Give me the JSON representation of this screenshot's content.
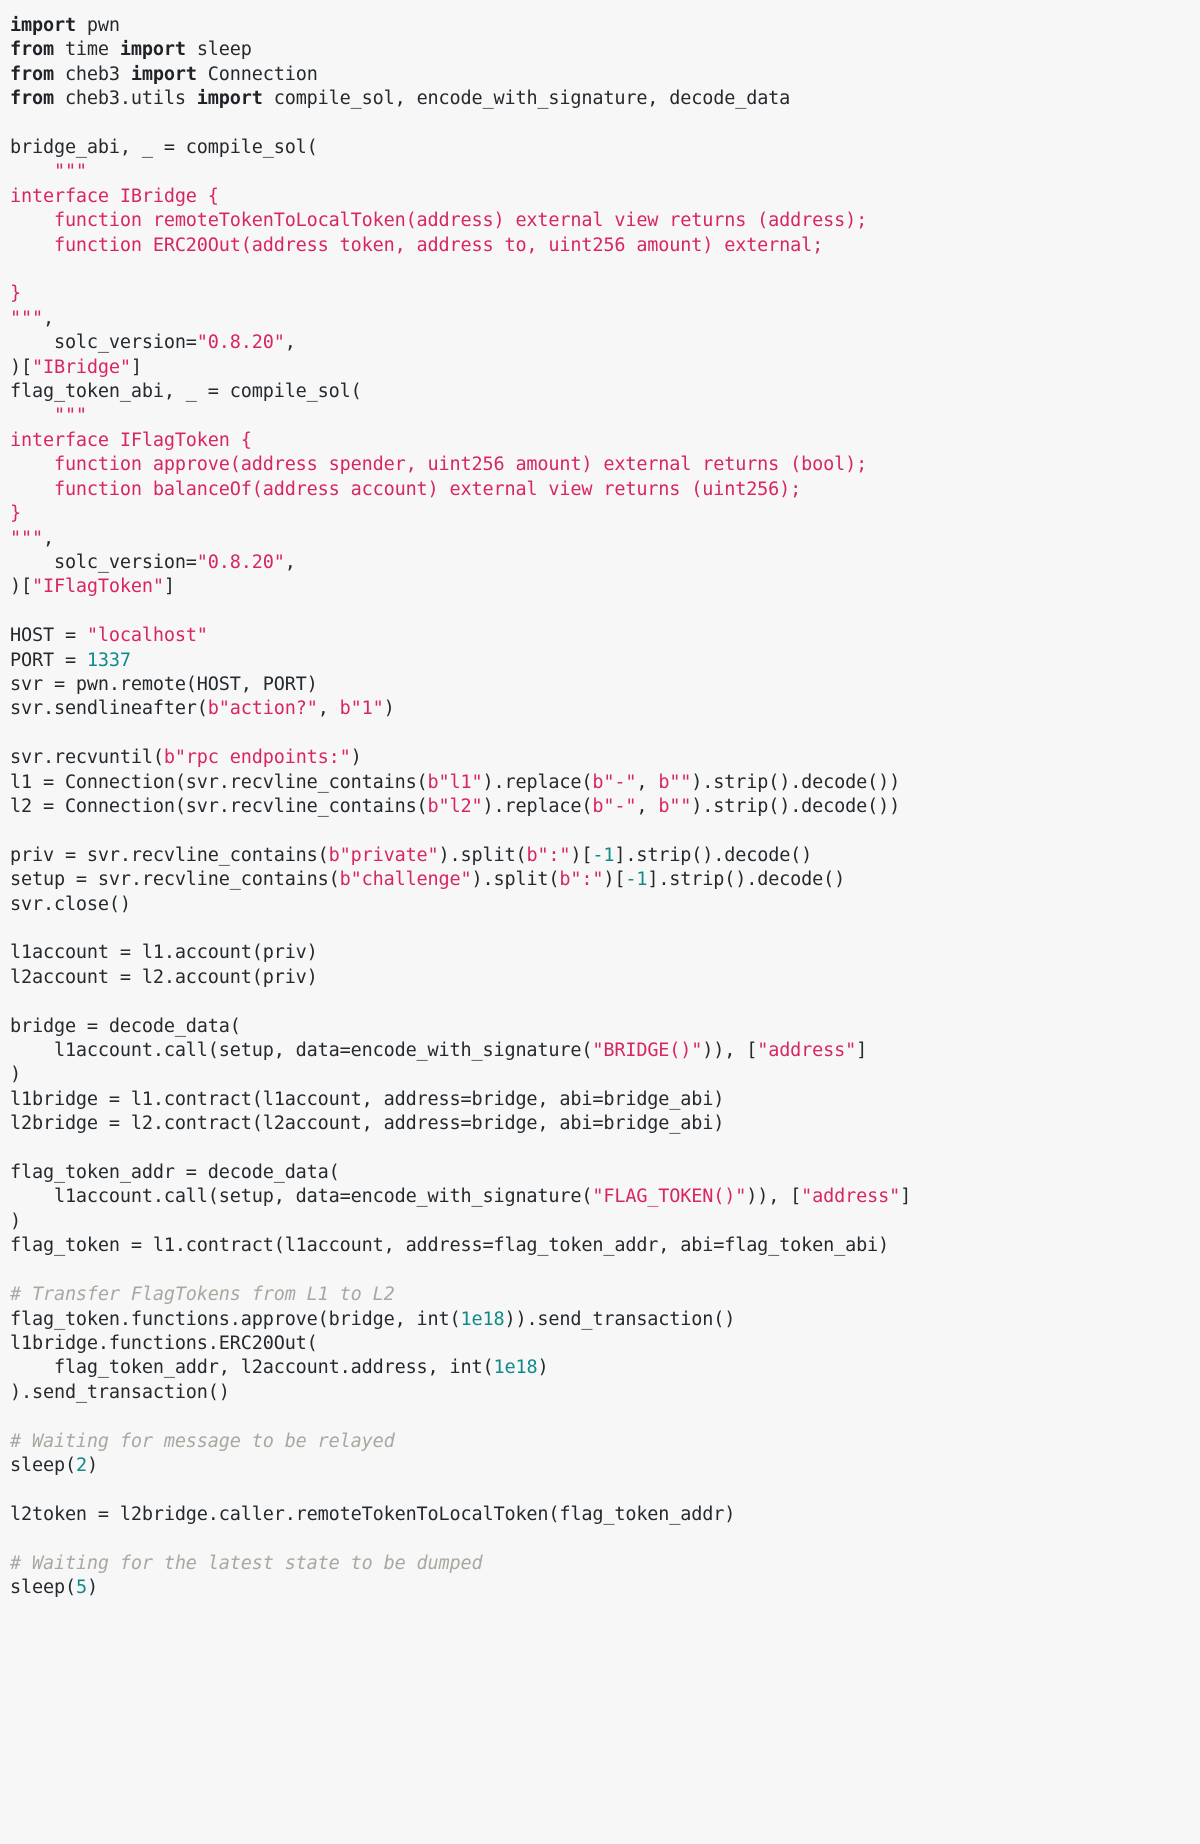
{
  "document": {
    "kind": "source-code",
    "language": "python",
    "background_color": "#f7f7f7",
    "colors": {
      "text": "#24292e",
      "keyword": "#1f2328",
      "string": "#d72660",
      "number": "#0f8a8a",
      "comment": "#a8a8a0"
    }
  },
  "lines": [
    [
      {
        "t": "kw",
        "v": "import"
      },
      {
        "t": "plain",
        "v": " pwn"
      }
    ],
    [
      {
        "t": "kw",
        "v": "from"
      },
      {
        "t": "plain",
        "v": " time "
      },
      {
        "t": "kw",
        "v": "import"
      },
      {
        "t": "plain",
        "v": " sleep"
      }
    ],
    [
      {
        "t": "kw",
        "v": "from"
      },
      {
        "t": "plain",
        "v": " cheb3 "
      },
      {
        "t": "kw",
        "v": "import"
      },
      {
        "t": "plain",
        "v": " Connection"
      }
    ],
    [
      {
        "t": "kw",
        "v": "from"
      },
      {
        "t": "plain",
        "v": " cheb3.utils "
      },
      {
        "t": "kw",
        "v": "import"
      },
      {
        "t": "plain",
        "v": " compile_sol, encode_with_signature, decode_data"
      }
    ],
    [],
    [
      {
        "t": "plain",
        "v": "bridge_abi, _ = compile_sol("
      }
    ],
    [
      {
        "t": "str",
        "v": "    \"\"\""
      }
    ],
    [
      {
        "t": "str",
        "v": "interface IBridge {"
      }
    ],
    [
      {
        "t": "str",
        "v": "    function remoteTokenToLocalToken(address) external view returns (address);"
      }
    ],
    [
      {
        "t": "str",
        "v": "    function ERC20Out(address token, address to, uint256 amount) external;"
      }
    ],
    [
      {
        "t": "str",
        "v": ""
      }
    ],
    [
      {
        "t": "str",
        "v": "}"
      }
    ],
    [
      {
        "t": "str",
        "v": "\"\"\""
      },
      {
        "t": "plain",
        "v": ","
      }
    ],
    [
      {
        "t": "plain",
        "v": "    solc_version="
      },
      {
        "t": "str",
        "v": "\"0.8.20\""
      },
      {
        "t": "plain",
        "v": ","
      }
    ],
    [
      {
        "t": "plain",
        "v": ")["
      },
      {
        "t": "str",
        "v": "\"IBridge\""
      },
      {
        "t": "plain",
        "v": "]"
      }
    ],
    [
      {
        "t": "plain",
        "v": "flag_token_abi, _ = compile_sol("
      }
    ],
    [
      {
        "t": "str",
        "v": "    \"\"\""
      }
    ],
    [
      {
        "t": "str",
        "v": "interface IFlagToken {"
      }
    ],
    [
      {
        "t": "str",
        "v": "    function approve(address spender, uint256 amount) external returns (bool);"
      }
    ],
    [
      {
        "t": "str",
        "v": "    function balanceOf(address account) external view returns (uint256);"
      }
    ],
    [
      {
        "t": "str",
        "v": "}"
      }
    ],
    [
      {
        "t": "str",
        "v": "\"\"\""
      },
      {
        "t": "plain",
        "v": ","
      }
    ],
    [
      {
        "t": "plain",
        "v": "    solc_version="
      },
      {
        "t": "str",
        "v": "\"0.8.20\""
      },
      {
        "t": "plain",
        "v": ","
      }
    ],
    [
      {
        "t": "plain",
        "v": ")["
      },
      {
        "t": "str",
        "v": "\"IFlagToken\""
      },
      {
        "t": "plain",
        "v": "]"
      }
    ],
    [],
    [
      {
        "t": "plain",
        "v": "HOST = "
      },
      {
        "t": "str",
        "v": "\"localhost\""
      }
    ],
    [
      {
        "t": "plain",
        "v": "PORT = "
      },
      {
        "t": "num",
        "v": "1337"
      }
    ],
    [
      {
        "t": "plain",
        "v": "svr = pwn.remote(HOST, PORT)"
      }
    ],
    [
      {
        "t": "plain",
        "v": "svr.sendlineafter("
      },
      {
        "t": "str",
        "v": "b\"action?\""
      },
      {
        "t": "plain",
        "v": ", "
      },
      {
        "t": "str",
        "v": "b\"1\""
      },
      {
        "t": "plain",
        "v": ")"
      }
    ],
    [],
    [
      {
        "t": "plain",
        "v": "svr.recvuntil("
      },
      {
        "t": "str",
        "v": "b\"rpc endpoints:\""
      },
      {
        "t": "plain",
        "v": ")"
      }
    ],
    [
      {
        "t": "plain",
        "v": "l1 = Connection(svr.recvline_contains("
      },
      {
        "t": "str",
        "v": "b\"l1\""
      },
      {
        "t": "plain",
        "v": ").replace("
      },
      {
        "t": "str",
        "v": "b\"-\""
      },
      {
        "t": "plain",
        "v": ", "
      },
      {
        "t": "str",
        "v": "b\"\""
      },
      {
        "t": "plain",
        "v": ").strip().decode())"
      }
    ],
    [
      {
        "t": "plain",
        "v": "l2 = Connection(svr.recvline_contains("
      },
      {
        "t": "str",
        "v": "b\"l2\""
      },
      {
        "t": "plain",
        "v": ").replace("
      },
      {
        "t": "str",
        "v": "b\"-\""
      },
      {
        "t": "plain",
        "v": ", "
      },
      {
        "t": "str",
        "v": "b\"\""
      },
      {
        "t": "plain",
        "v": ").strip().decode())"
      }
    ],
    [],
    [
      {
        "t": "plain",
        "v": "priv = svr.recvline_contains("
      },
      {
        "t": "str",
        "v": "b\"private\""
      },
      {
        "t": "plain",
        "v": ").split("
      },
      {
        "t": "str",
        "v": "b\":\""
      },
      {
        "t": "plain",
        "v": ")["
      },
      {
        "t": "num",
        "v": "-1"
      },
      {
        "t": "plain",
        "v": "].strip().decode()"
      }
    ],
    [
      {
        "t": "plain",
        "v": "setup = svr.recvline_contains("
      },
      {
        "t": "str",
        "v": "b\"challenge\""
      },
      {
        "t": "plain",
        "v": ").split("
      },
      {
        "t": "str",
        "v": "b\":\""
      },
      {
        "t": "plain",
        "v": ")["
      },
      {
        "t": "num",
        "v": "-1"
      },
      {
        "t": "plain",
        "v": "].strip().decode()"
      }
    ],
    [
      {
        "t": "plain",
        "v": "svr.close()"
      }
    ],
    [],
    [
      {
        "t": "plain",
        "v": "l1account = l1.account(priv)"
      }
    ],
    [
      {
        "t": "plain",
        "v": "l2account = l2.account(priv)"
      }
    ],
    [],
    [
      {
        "t": "plain",
        "v": "bridge = decode_data("
      }
    ],
    [
      {
        "t": "plain",
        "v": "    l1account.call(setup, data=encode_with_signature("
      },
      {
        "t": "str",
        "v": "\"BRIDGE()\""
      },
      {
        "t": "plain",
        "v": ")), ["
      },
      {
        "t": "str",
        "v": "\"address\""
      },
      {
        "t": "plain",
        "v": "]"
      }
    ],
    [
      {
        "t": "plain",
        "v": ")"
      }
    ],
    [
      {
        "t": "plain",
        "v": "l1bridge = l1.contract(l1account, address=bridge, abi=bridge_abi)"
      }
    ],
    [
      {
        "t": "plain",
        "v": "l2bridge = l2.contract(l2account, address=bridge, abi=bridge_abi)"
      }
    ],
    [],
    [
      {
        "t": "plain",
        "v": "flag_token_addr = decode_data("
      }
    ],
    [
      {
        "t": "plain",
        "v": "    l1account.call(setup, data=encode_with_signature("
      },
      {
        "t": "str",
        "v": "\"FLAG_TOKEN()\""
      },
      {
        "t": "plain",
        "v": ")), ["
      },
      {
        "t": "str",
        "v": "\"address\""
      },
      {
        "t": "plain",
        "v": "]"
      }
    ],
    [
      {
        "t": "plain",
        "v": ")"
      }
    ],
    [
      {
        "t": "plain",
        "v": "flag_token = l1.contract(l1account, address=flag_token_addr, abi=flag_token_abi)"
      }
    ],
    [],
    [
      {
        "t": "com",
        "v": "# Transfer FlagTokens from L1 to L2"
      }
    ],
    [
      {
        "t": "plain",
        "v": "flag_token.functions.approve(bridge, int("
      },
      {
        "t": "num",
        "v": "1e18"
      },
      {
        "t": "plain",
        "v": ")).send_transaction()"
      }
    ],
    [
      {
        "t": "plain",
        "v": "l1bridge.functions.ERC20Out("
      }
    ],
    [
      {
        "t": "plain",
        "v": "    flag_token_addr, l2account.address, int("
      },
      {
        "t": "num",
        "v": "1e18"
      },
      {
        "t": "plain",
        "v": ")"
      }
    ],
    [
      {
        "t": "plain",
        "v": ").send_transaction()"
      }
    ],
    [],
    [
      {
        "t": "com",
        "v": "# Waiting for message to be relayed"
      }
    ],
    [
      {
        "t": "plain",
        "v": "sleep("
      },
      {
        "t": "num",
        "v": "2"
      },
      {
        "t": "plain",
        "v": ")"
      }
    ],
    [],
    [
      {
        "t": "plain",
        "v": "l2token = l2bridge.caller.remoteTokenToLocalToken(flag_token_addr)"
      }
    ],
    [],
    [
      {
        "t": "com",
        "v": "# Waiting for the latest state to be dumped"
      }
    ],
    [
      {
        "t": "plain",
        "v": "sleep("
      },
      {
        "t": "num",
        "v": "5"
      },
      {
        "t": "plain",
        "v": ")"
      }
    ]
  ]
}
